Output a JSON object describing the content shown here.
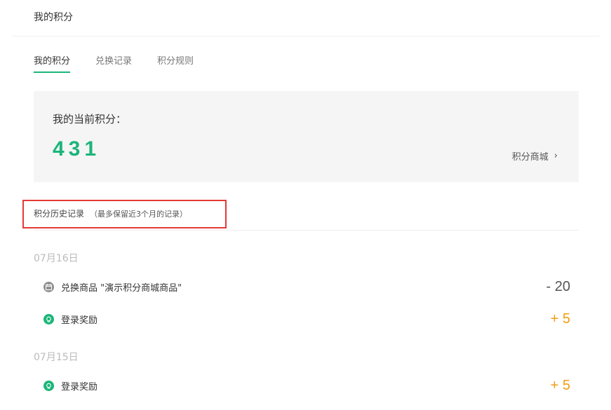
{
  "page": {
    "title": "我的积分"
  },
  "tabs": [
    {
      "label": "我的积分",
      "active": true
    },
    {
      "label": "兑换记录",
      "active": false
    },
    {
      "label": "积分规则",
      "active": false
    }
  ],
  "points": {
    "label": "我的当前积分：",
    "value": "431",
    "mall_link": "积分商城"
  },
  "history": {
    "title": "积分历史记录",
    "note": "（最多保留近3个月的记录）",
    "groups": [
      {
        "date": "07月16日",
        "records": [
          {
            "icon": "calendar-icon",
            "description": "兑换商品 \"演示积分商城商品\"",
            "delta": "- 20"
          },
          {
            "icon": "login-reward-icon",
            "description": "登录奖励",
            "delta": "+ 5"
          }
        ]
      },
      {
        "date": "07月15日",
        "records": [
          {
            "icon": "login-reward-icon",
            "description": "登录奖励",
            "delta": "+ 5"
          }
        ]
      }
    ]
  },
  "colors": {
    "accent": "#1cb57a",
    "positive": "#f39c12",
    "highlight_border": "#e53935"
  }
}
